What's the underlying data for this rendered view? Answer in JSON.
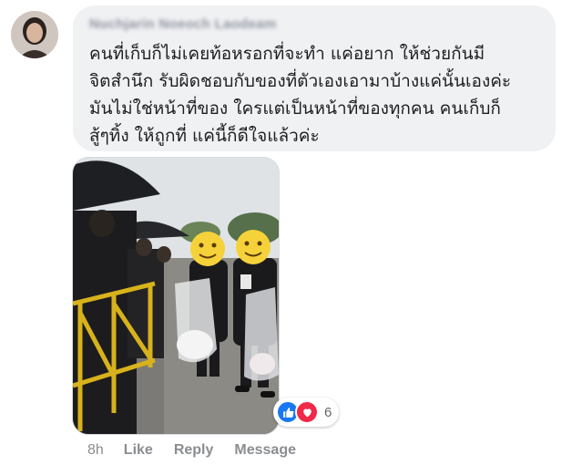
{
  "comment": {
    "author_name": "Nuchjarin Noeoch Laodeam",
    "text_lines": [
      "คนที่เก็บก็ไม่เคยท้อหรอกที่จะทำ แค่อยาก ให้ช่วยกันมี",
      "จิตสำนึก รับผิดชอบกับของที่ตัวเองเอามาบ้างแค่นั้นเองค่ะ",
      "มันไม่ใช่หน้าที่ของ ใครแต่เป็นหน้าที่ของทุกคน คนเก็บก็",
      "สู้ๆทิ้ง ให้ถูกที่ แค่นี้ก็ดีใจแล้วค่ะ"
    ]
  },
  "reactions": {
    "icons": [
      "like-icon",
      "love-icon"
    ],
    "count": "6",
    "colors": {
      "like": "#1877f2",
      "love": "#f0284a"
    }
  },
  "actions": {
    "time": "8h",
    "like": "Like",
    "reply": "Reply",
    "message": "Message"
  },
  "colors": {
    "bubble": "#f0f1f3",
    "action_text": "#8a8d91"
  }
}
